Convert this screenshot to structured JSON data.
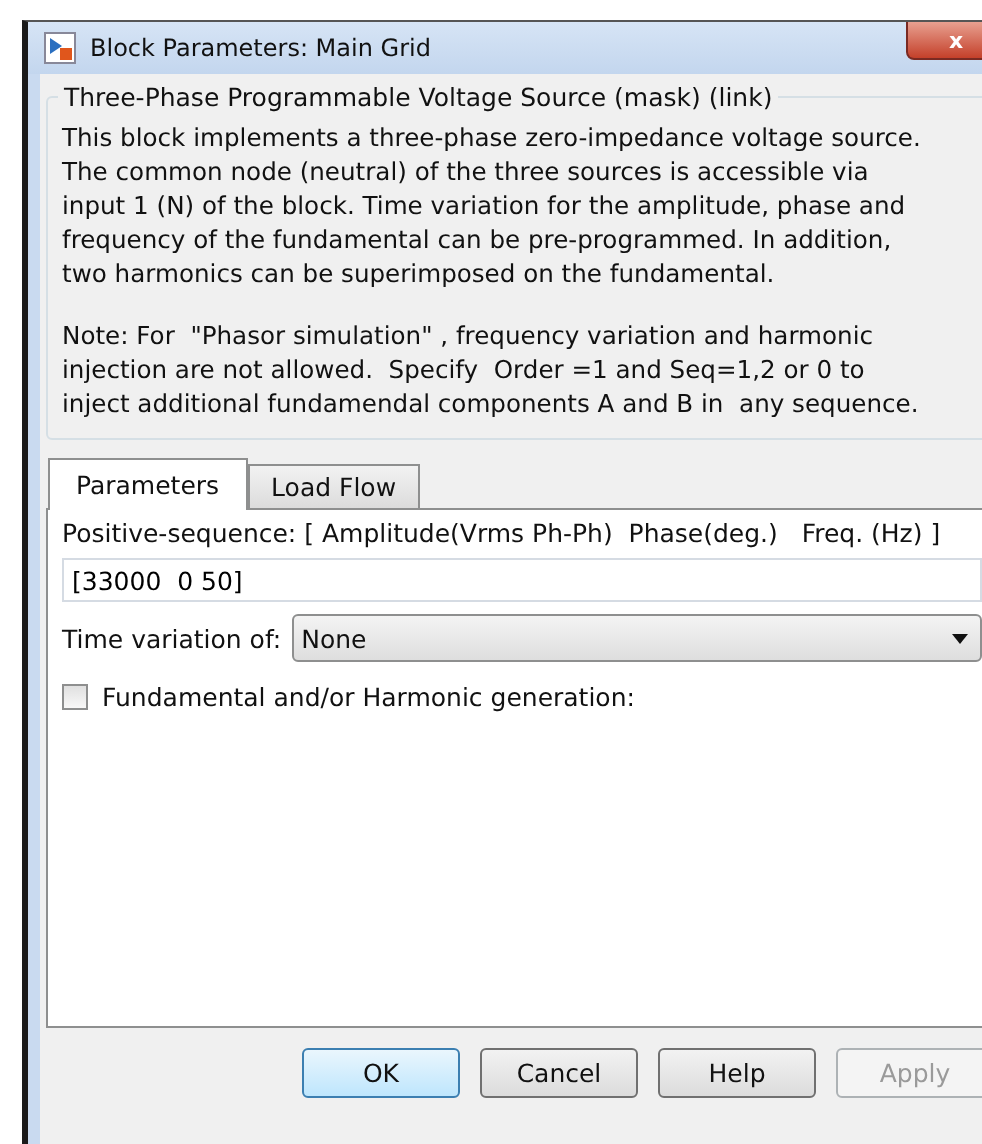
{
  "window": {
    "title": "Block Parameters: Main Grid",
    "close": "x"
  },
  "group": {
    "title": "Three-Phase Programmable Voltage Source (mask) (link)",
    "paragraphs": [
      "This block implements a three-phase zero-impedance voltage source.\nThe common node (neutral) of the three sources is accessible via\ninput 1 (N) of the block. Time variation for the amplitude, phase and\nfrequency of the fundamental can be pre-programmed. In addition,\ntwo harmonics can be superimposed on the fundamental.",
      "Note: For  \"Phasor simulation\" , frequency variation and harmonic\ninjection are not allowed.  Specify  Order =1 and Seq=1,2 or 0 to\ninject additional fundamendal components A and B in  any sequence."
    ]
  },
  "tabs": [
    {
      "label": "Parameters",
      "selected": true
    },
    {
      "label": "Load Flow",
      "selected": false
    }
  ],
  "fields": {
    "sequence_label": "Positive-sequence: [ Amplitude(Vrms Ph-Ph)  Phase(deg.)   Freq. (Hz) ]",
    "sequence_value": "[33000  0 50]",
    "time_variation_label": "Time variation of:",
    "time_variation_value": "None",
    "harmonic_label": "Fundamental and/or Harmonic generation:",
    "harmonic_checked": false
  },
  "buttons": [
    {
      "label": "OK",
      "default": true,
      "disabled": false
    },
    {
      "label": "Cancel",
      "default": false,
      "disabled": false
    },
    {
      "label": "Help",
      "default": false,
      "disabled": false
    },
    {
      "label": "Apply",
      "default": false,
      "disabled": true
    }
  ]
}
